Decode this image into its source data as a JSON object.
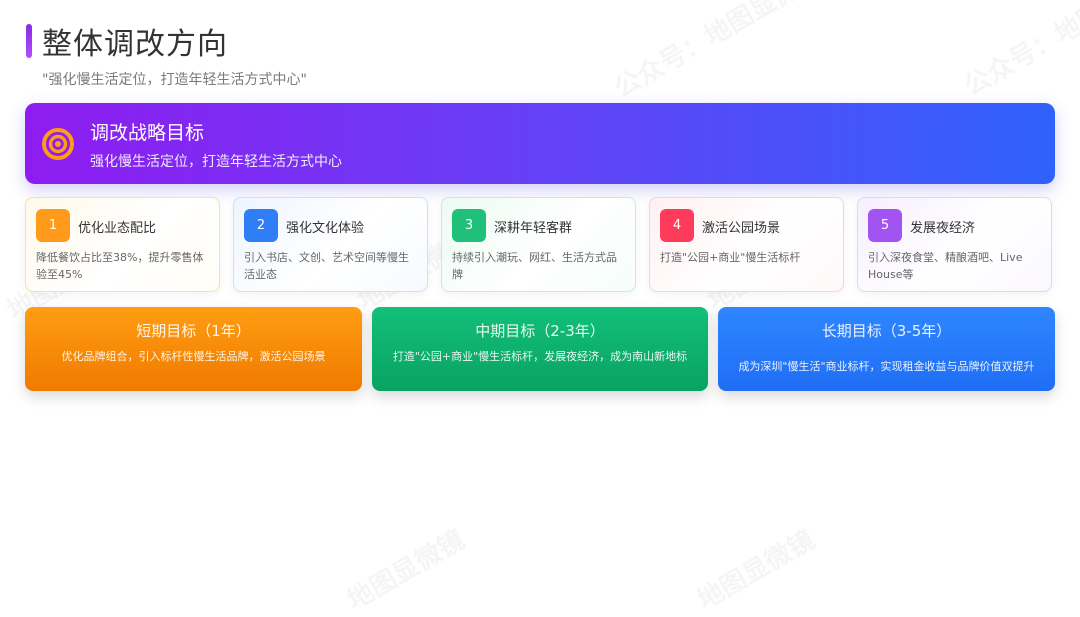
{
  "header": {
    "title": "整体调改方向",
    "subtitle": "\"强化慢生活定位，打造年轻生活方式中心\""
  },
  "banner": {
    "icon": "target-icon",
    "title": "调改战略目标",
    "subtitle": "强化慢生活定位，打造年轻生活方式中心"
  },
  "cards": [
    {
      "num": "1",
      "title": "优化业态配比",
      "desc": "降低餐饮占比至38%，提升零售体验至45%",
      "color": "#ff9a1a"
    },
    {
      "num": "2",
      "title": "强化文化体验",
      "desc": "引入书店、文创、艺术空间等慢生活业态",
      "color": "#2f7ef5"
    },
    {
      "num": "3",
      "title": "深耕年轻客群",
      "desc": "持续引入潮玩、网红、生活方式品牌",
      "color": "#1ec07a"
    },
    {
      "num": "4",
      "title": "激活公园场景",
      "desc": "打造\"公园+商业\"慢生活标杆",
      "color": "#ff3b5c"
    },
    {
      "num": "5",
      "title": "发展夜经济",
      "desc": "引入深夜食堂、精酿酒吧、Live House等",
      "color": "#a154f2"
    }
  ],
  "goals": [
    {
      "title": "短期目标（1年）",
      "desc": "优化品牌组合，引入标杆性慢生活品牌，激活公园场景"
    },
    {
      "title": "中期目标（2-3年）",
      "desc": "打造\"公园+商业\"慢生活标杆，发展夜经济，成为南山新地标"
    },
    {
      "title": "长期目标（3-5年）",
      "desc": "成为深圳\"慢生活\"商业标杆，实现租金收益与品牌价值双提升"
    }
  ],
  "watermark": {
    "text1": "公众号：地图显微镜",
    "text2": "地图显微镜"
  }
}
